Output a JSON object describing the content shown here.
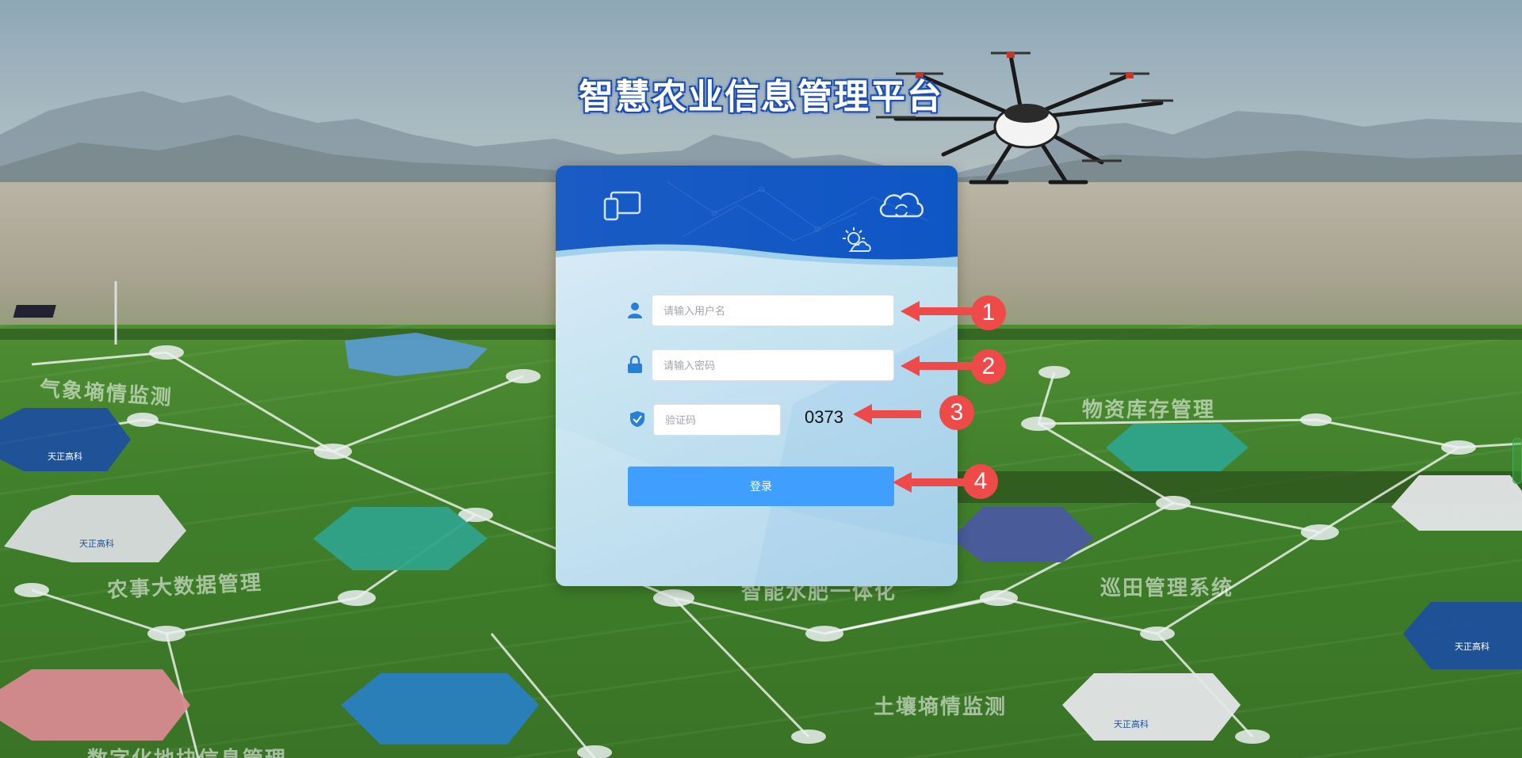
{
  "page": {
    "title": "智慧农业信息管理平台"
  },
  "background_labels": [
    "气象墒情监测",
    "物资库存管理",
    "农事大数据管理",
    "智能水肥一体化",
    "巡田管理系统",
    "土壤墒情监测",
    "数字化地块信息管理"
  ],
  "hex_brand": "天正高科",
  "login_form": {
    "username": {
      "placeholder": "请输入用户名",
      "value": ""
    },
    "password": {
      "placeholder": "请输入密码",
      "value": ""
    },
    "captcha": {
      "placeholder": "验证码",
      "value": "",
      "code": "0373"
    },
    "submit_label": "登录"
  },
  "annotations": [
    "1",
    "2",
    "3",
    "4"
  ],
  "colors": {
    "accent": "#409eff",
    "badge": "#ef4a4a",
    "card_header": "#1560c8",
    "icon_blue": "#2a7fd4"
  },
  "icons": {
    "user": "user-icon",
    "lock": "lock-icon",
    "shield": "shield-check-icon",
    "tablet": "tablet-icon",
    "cloud": "cloud-sync-icon",
    "sun": "sun-cloud-icon"
  }
}
